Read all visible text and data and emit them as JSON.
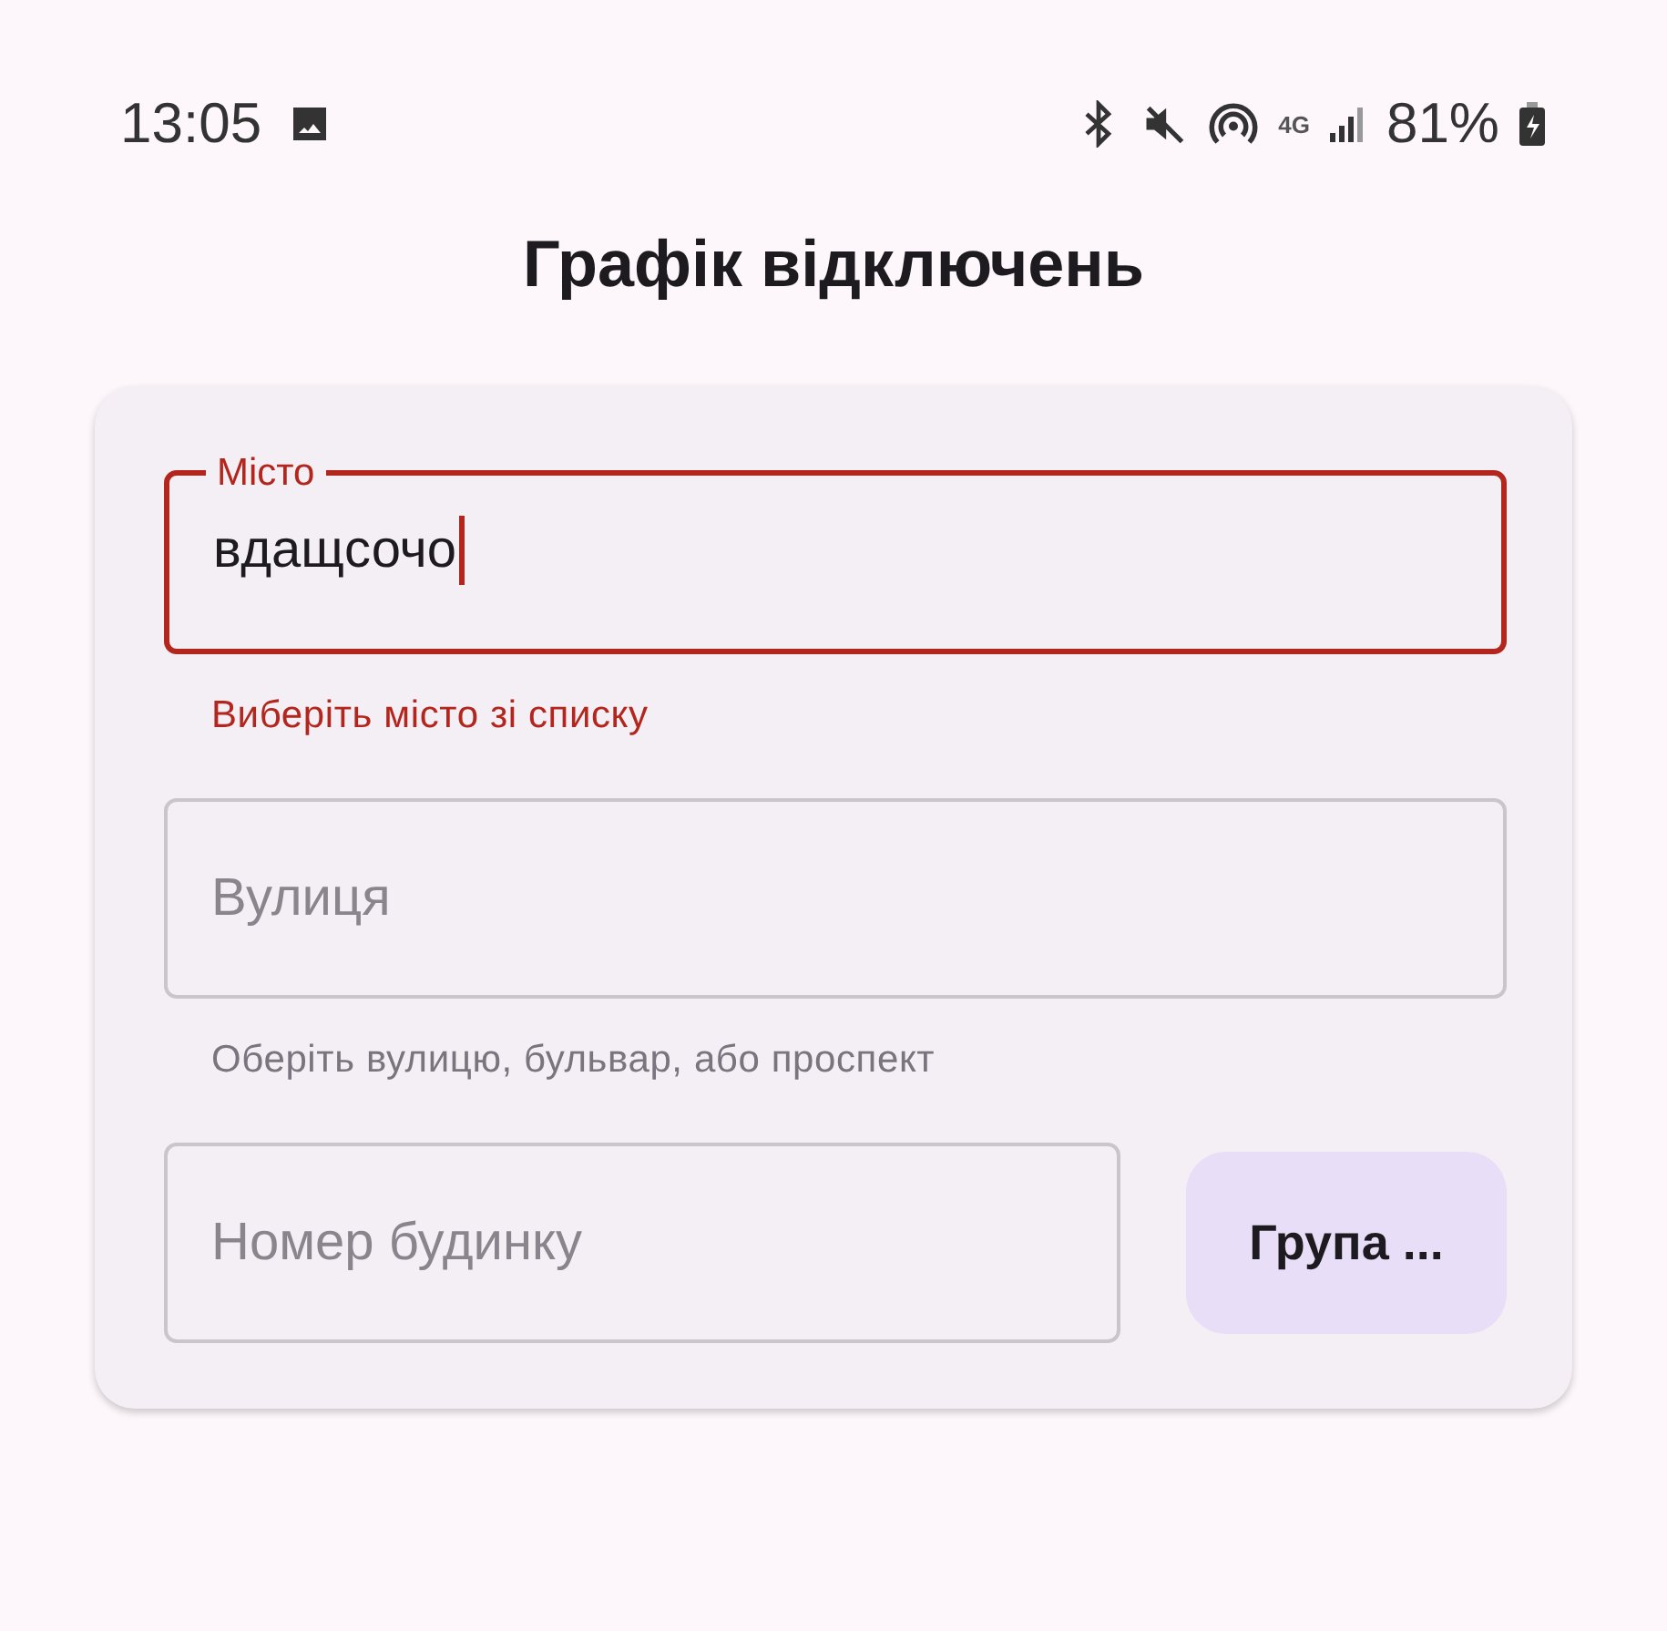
{
  "status_bar": {
    "time": "13:05",
    "network": "4G",
    "battery": "81%"
  },
  "title": "Графік відключень",
  "fields": [
    {
      "kind": "text",
      "label": "Місто",
      "value": "вдащсочо",
      "focused": true,
      "error": true,
      "helper": "Виберіть місто зі списку"
    },
    {
      "kind": "text",
      "placeholder": "Вулиця",
      "focused": false,
      "error": false,
      "helper": "Оберіть вулицю, бульвар, або проспект"
    },
    {
      "kind": "text_with_button",
      "placeholder": "Номер будинку",
      "focused": false,
      "error": false,
      "button": "Група ..."
    }
  ]
}
